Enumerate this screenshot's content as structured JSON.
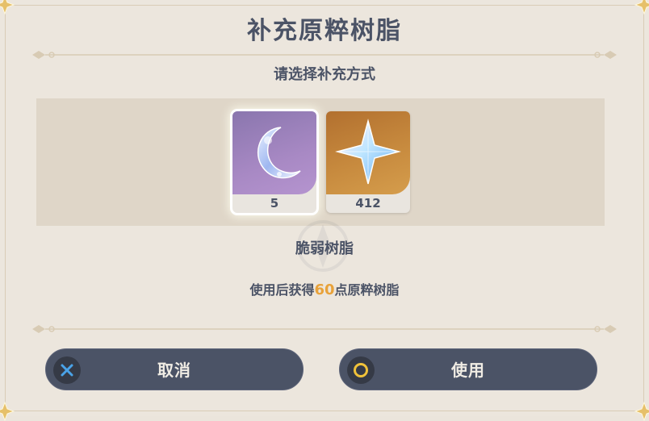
{
  "dialog": {
    "title": "补充原粹树脂",
    "subtitle": "请选择补充方式"
  },
  "options": [
    {
      "name": "fragile-resin",
      "count": "5",
      "selected": true,
      "icon": "moon-crescent-icon"
    },
    {
      "name": "primogem",
      "count": "412",
      "selected": false,
      "icon": "primogem-star-icon"
    }
  ],
  "selected_item": {
    "name": "脆弱树脂",
    "desc_prefix": "使用后获得",
    "desc_amount": "60",
    "desc_suffix": "点原粹树脂"
  },
  "buttons": {
    "cancel": {
      "label": "取消",
      "icon": "x-button-icon"
    },
    "confirm": {
      "label": "使用",
      "icon": "circle-button-icon"
    }
  },
  "colors": {
    "text": "#4b5366",
    "highlight": "#e8a23a",
    "button_bg": "#4b5366",
    "band": "#dfd6c8"
  }
}
